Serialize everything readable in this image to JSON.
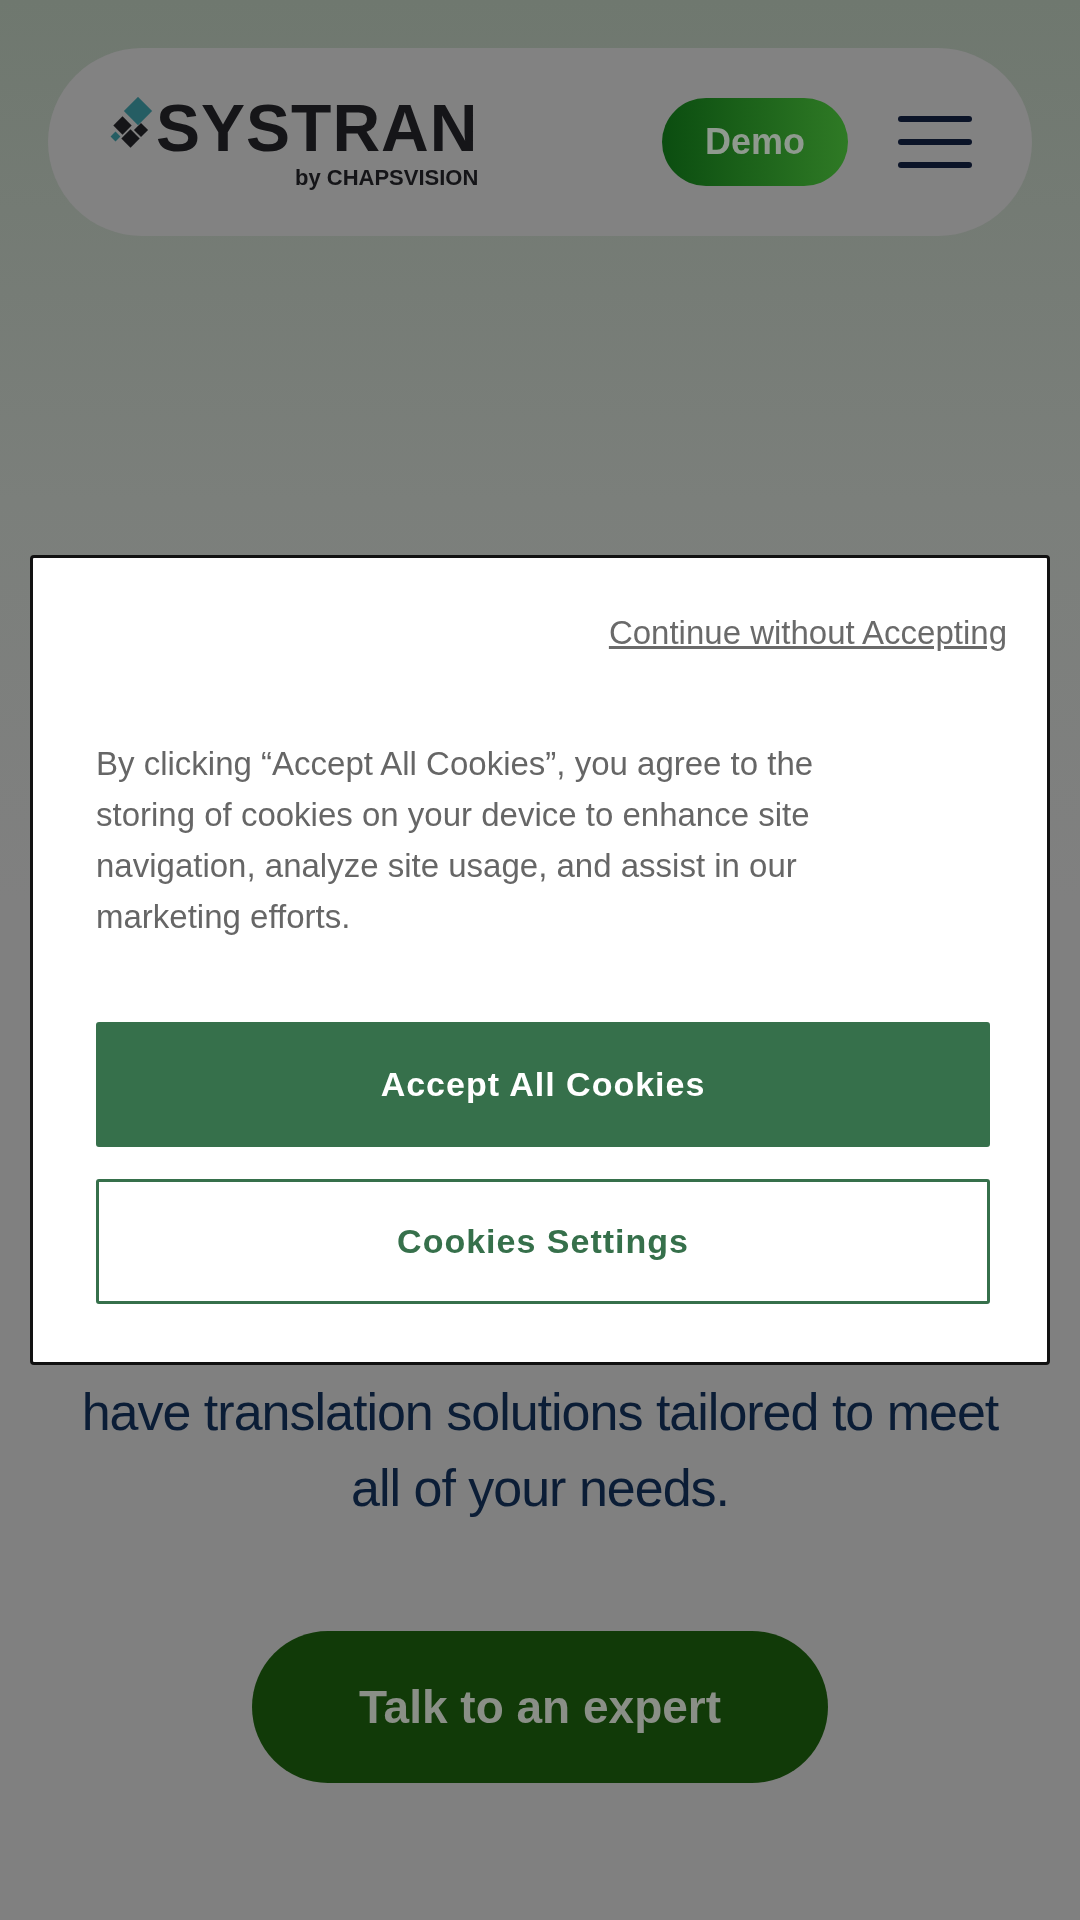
{
  "header": {
    "logo_text": "SYSTRAN",
    "logo_subtext": "by CHAPSVISION",
    "demo_button": "Demo"
  },
  "hero": {
    "text": "have translation solutions tailored to meet all of your needs.",
    "cta_button": "Talk to an expert"
  },
  "cookie_dialog": {
    "continue_link": "Continue without Accepting",
    "message": "By clicking “Accept All Cookies”, you agree to the storing of cookies on your device to enhance site navigation, analyze site usage, and assist in our marketing efforts.",
    "buttons": [
      {
        "label": "Accept All Cookies",
        "kind": "primary"
      },
      {
        "label": "Cookies Settings",
        "kind": "outline"
      }
    ]
  }
}
